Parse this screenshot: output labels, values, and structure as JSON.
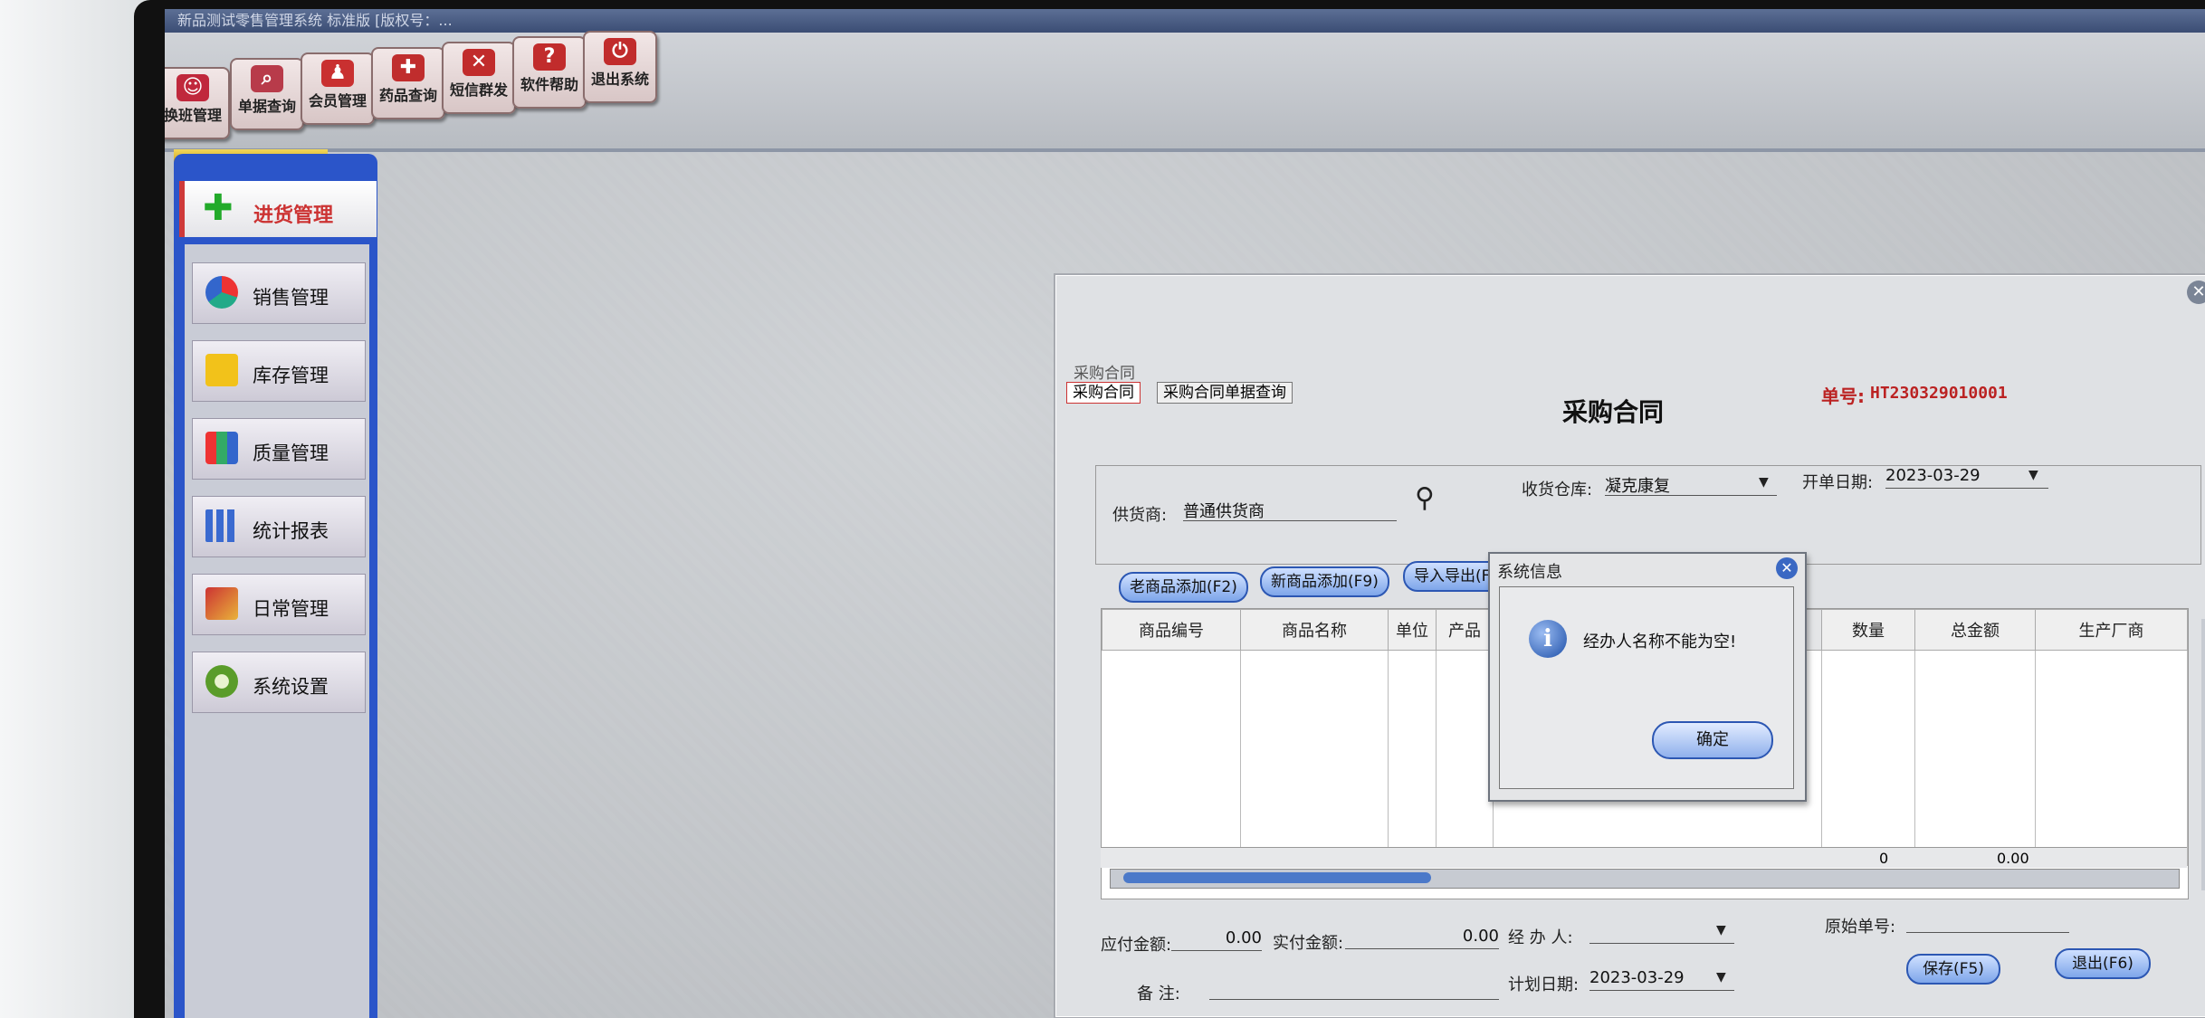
{
  "app": {
    "title_fragment": "新品测试零售管理系统 标准版 [版权号：..."
  },
  "toolbar": {
    "buttons": [
      {
        "label": "换班管理",
        "icon": "shift-icon",
        "color": "#c0283c"
      },
      {
        "label": "单据查询",
        "icon": "search-doc-icon",
        "color": "#b83b4a"
      },
      {
        "label": "会员管理",
        "icon": "member-icon",
        "color": "#c93030"
      },
      {
        "label": "药品查询",
        "icon": "medicine-icon",
        "color": "#c02d2d"
      },
      {
        "label": "短信群发",
        "icon": "mail-icon",
        "color": "#c12c2c"
      },
      {
        "label": "软件帮助",
        "icon": "help-icon",
        "color": "#c12c2c"
      },
      {
        "label": "退出系统",
        "icon": "exit-icon",
        "color": "#c12c2c"
      }
    ]
  },
  "sidebar": {
    "active": {
      "label": "进货管理",
      "icon": "plus-icon"
    },
    "items": [
      {
        "label": "销售管理",
        "icon": "pie-chart-icon"
      },
      {
        "label": "库存管理",
        "icon": "star-icon"
      },
      {
        "label": "质量管理",
        "icon": "cubes-icon"
      },
      {
        "label": "统计报表",
        "icon": "bar-chart-icon"
      },
      {
        "label": "日常管理",
        "icon": "tools-icon"
      },
      {
        "label": "系统设置",
        "icon": "gear-icon"
      }
    ]
  },
  "window": {
    "title": "采购合同",
    "tabs": [
      {
        "label": "采购合同",
        "active": true
      },
      {
        "label": "采购合同单据查询",
        "active": false
      }
    ],
    "form_title": "采购合同",
    "doc_number_label": "单号:",
    "doc_number": "HT230329010001",
    "supplier_label": "供货商:",
    "supplier_value": "普通供货商",
    "warehouse_label": "收货仓库:",
    "warehouse_value": "凝克康复",
    "open_date_label": "开单日期:",
    "open_date_value": "2023-03-29",
    "actions": {
      "old_add": "老商品添加(F2)",
      "new_add": "新商品添加(F9)",
      "import_export": "导入导出(F10)"
    },
    "grid": {
      "columns": [
        "商品编号",
        "商品名称",
        "单位",
        "产品",
        "数量",
        "总金额",
        "生产厂商"
      ],
      "sum_qty": "0",
      "sum_amount": "0.00"
    },
    "payable_label": "应付金额:",
    "payable_value": "0.00",
    "paid_label": "实付金额:",
    "paid_value": "0.00",
    "handler_label": "经 办 人:",
    "handler_value": "",
    "orig_no_label": "原始单号:",
    "orig_no_value": "",
    "remark_label": "备    注:",
    "remark_value": "",
    "plan_date_label": "计划日期:",
    "plan_date_value": "2023-03-29",
    "save_label": "保存(F5)",
    "exit_label": "退出(F6)"
  },
  "dialog": {
    "title": "系统信息",
    "message": "经办人名称不能为空!",
    "ok_label": "确定",
    "icon": "info-icon"
  }
}
